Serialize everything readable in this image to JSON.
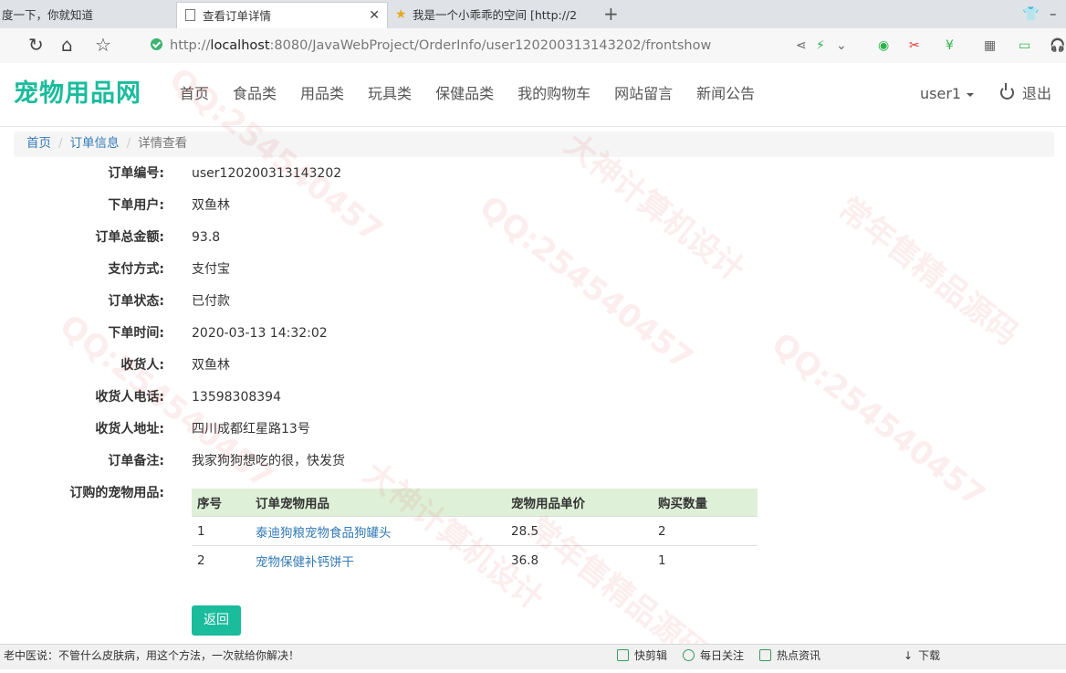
{
  "browser": {
    "tabs": [
      {
        "title": "度一下，你就知道"
      },
      {
        "title": "查看订单详情"
      },
      {
        "title": "我是一个小乖乖的空间 [http://2"
      }
    ],
    "url_prefix": "http://",
    "url_host": "localhost",
    "url_rest": ":8080/JavaWebProject/OrderInfo/user120200313143202/frontshow"
  },
  "navbar": {
    "brand": "宠物用品网",
    "menu": [
      "首页",
      "食品类",
      "用品类",
      "玩具类",
      "保健品类",
      "我的购物车",
      "网站留言",
      "新闻公告"
    ],
    "user": "user1",
    "logout": "退出"
  },
  "breadcrumb": {
    "home": "首页",
    "section": "订单信息",
    "current": "详情查看",
    "separator": "/"
  },
  "order": {
    "fields": [
      {
        "label": "订单编号:",
        "value": "user120200313143202"
      },
      {
        "label": "下单用户:",
        "value": "双鱼林"
      },
      {
        "label": "订单总金额:",
        "value": "93.8"
      },
      {
        "label": "支付方式:",
        "value": "支付宝"
      },
      {
        "label": "订单状态:",
        "value": "已付款"
      },
      {
        "label": "下单时间:",
        "value": "2020-03-13 14:32:02"
      },
      {
        "label": "收货人:",
        "value": "双鱼林"
      },
      {
        "label": "收货人电话:",
        "value": "13598308394"
      },
      {
        "label": "收货人地址:",
        "value": "四川成都红星路13号"
      },
      {
        "label": "订单备注:",
        "value": "我家狗狗想吃的很，快发货"
      }
    ],
    "items_label": "订购的宠物用品:",
    "items_table": {
      "headers": [
        "序号",
        "订单宠物用品",
        "宠物用品单价",
        "购买数量"
      ],
      "rows": [
        [
          "1",
          "泰迪狗粮宠物食品狗罐头",
          "28.5",
          "2"
        ],
        [
          "2",
          "宠物保健补钙饼干",
          "36.8",
          "1"
        ]
      ]
    },
    "back_button": "返回"
  },
  "statusbar": {
    "news": "老中医说：不管什么皮肤病，用这个方法，一次就给你解决！",
    "items": [
      "快剪辑",
      "每日关注",
      "热点资讯",
      "下载"
    ]
  },
  "watermark": [
    "QQ:254540457",
    "大神计算机设计",
    "常年售精品源码"
  ],
  "colors": {
    "brand": "#1abc9c",
    "link": "#337ab7",
    "table_header_bg": "#dff0d8",
    "button_bg": "#1abc9c"
  }
}
